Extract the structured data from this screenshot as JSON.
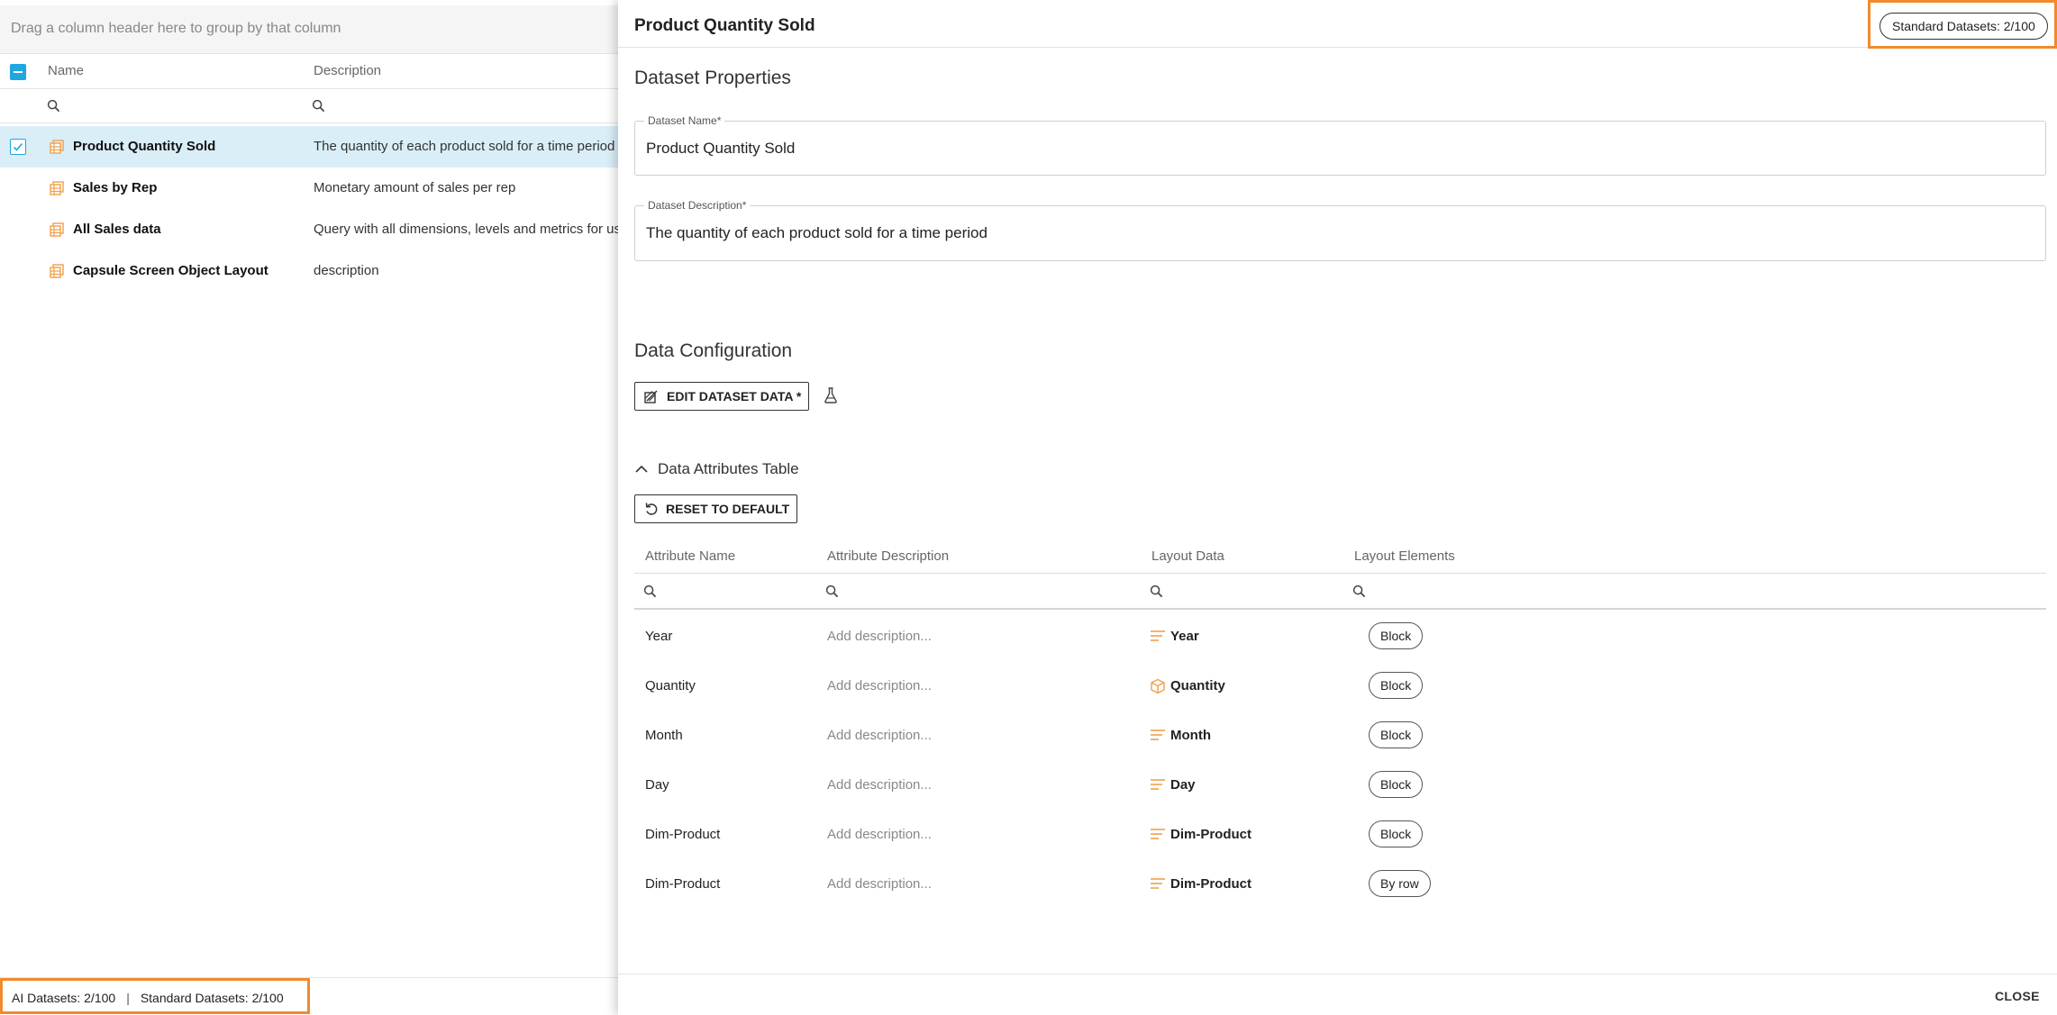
{
  "grid": {
    "group_hint": "Drag a column header here to group by that column",
    "columns": {
      "name": "Name",
      "description": "Description"
    },
    "rows": [
      {
        "name": "Product Quantity Sold",
        "description": "The quantity of each product sold for a time period",
        "selected": true
      },
      {
        "name": "Sales by Rep",
        "description": "Monetary amount of sales per rep",
        "selected": false
      },
      {
        "name": "All Sales data",
        "description": "Query with all dimensions, levels and metrics for use i",
        "selected": false
      },
      {
        "name": "Capsule Screen Object Layout",
        "description": "description",
        "selected": false
      }
    ]
  },
  "status_bar": {
    "ai_datasets": "AI Datasets: 2/100",
    "separator": "|",
    "standard_datasets": "Standard Datasets: 2/100"
  },
  "panel": {
    "title": "Product Quantity Sold",
    "badge": "Standard Datasets: 2/100",
    "properties_title": "Dataset Properties",
    "name_field": {
      "label": "Dataset Name*",
      "value": "Product Quantity Sold"
    },
    "desc_field": {
      "label": "Dataset Description*",
      "value": "The quantity of each product sold for a time period"
    },
    "config_title": "Data Configuration",
    "edit_button": "EDIT DATASET DATA *",
    "attributes_toggle": "Data Attributes Table",
    "reset_button": "RESET TO DEFAULT",
    "attr_columns": {
      "name": "Attribute Name",
      "description": "Attribute Description",
      "layout_data": "Layout Data",
      "layout_elements": "Layout Elements"
    },
    "attributes": [
      {
        "name": "Year",
        "description": "Add description...",
        "layout_data": "Year",
        "layout_icon": "dimension-lines-icon",
        "layout_element": "Block"
      },
      {
        "name": "Quantity",
        "description": "Add description...",
        "layout_data": "Quantity",
        "layout_icon": "cube-icon",
        "layout_element": "Block"
      },
      {
        "name": "Month",
        "description": "Add description...",
        "layout_data": "Month",
        "layout_icon": "dimension-lines-icon",
        "layout_element": "Block"
      },
      {
        "name": "Day",
        "description": "Add description...",
        "layout_data": "Day",
        "layout_icon": "dimension-lines-icon",
        "layout_element": "Block"
      },
      {
        "name": "Dim-Product",
        "description": "Add description...",
        "layout_data": "Dim-Product",
        "layout_icon": "dimension-lines-icon",
        "layout_element": "Block"
      },
      {
        "name": "Dim-Product",
        "description": "Add description...",
        "layout_data": "Dim-Product",
        "layout_icon": "dimension-lines-icon",
        "layout_element": "By row"
      }
    ],
    "close_button": "CLOSE"
  },
  "colors": {
    "accent_blue": "#1ea7e1",
    "selected_row": "#daeef8",
    "highlight_orange": "#f08a2c",
    "icon_orange": "#f0a04b"
  }
}
